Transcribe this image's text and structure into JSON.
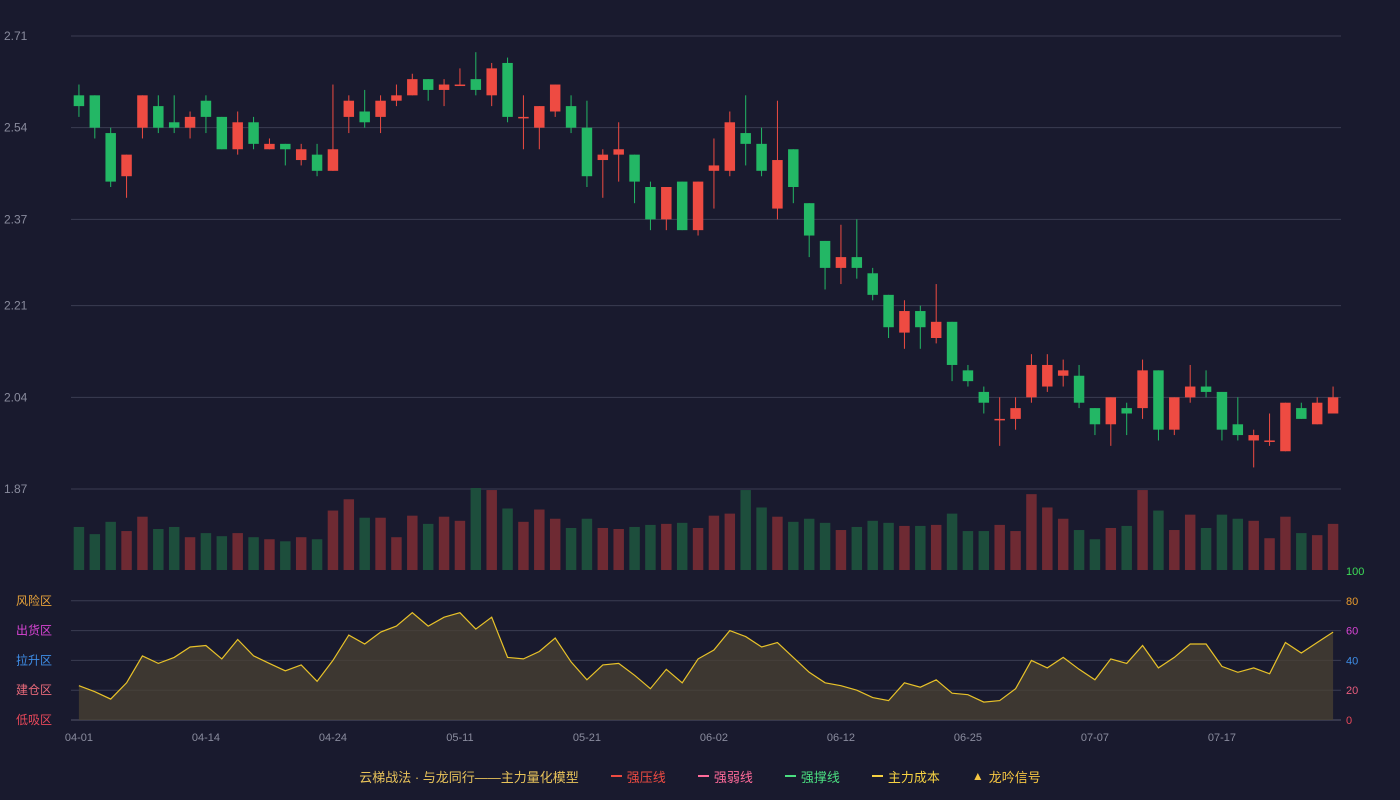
{
  "chart_data": {
    "type": "candlestick",
    "price_axis": {
      "ticks": [
        "2.71",
        "2.54",
        "2.37",
        "2.21",
        "2.04",
        "1.87"
      ],
      "ylim": [
        1.87,
        2.71
      ]
    },
    "x_ticks": [
      {
        "label": "04-01",
        "index": 0
      },
      {
        "label": "04-14",
        "index": 8
      },
      {
        "label": "04-24",
        "index": 16
      },
      {
        "label": "05-11",
        "index": 24
      },
      {
        "label": "05-21",
        "index": 32
      },
      {
        "label": "06-02",
        "index": 40
      },
      {
        "label": "06-12",
        "index": 48
      },
      {
        "label": "06-25",
        "index": 56
      },
      {
        "label": "07-07",
        "index": 64
      },
      {
        "label": "07-17",
        "index": 72
      }
    ],
    "colors": {
      "up": "#ee4b42",
      "down": "#23b765",
      "vol_up": "#6e2a33",
      "vol_down": "#1d4e3c",
      "indicator": "#e8c229"
    },
    "candles": [
      [
        2.6,
        2.58,
        2.62,
        2.56
      ],
      [
        2.6,
        2.54,
        2.6,
        2.52
      ],
      [
        2.53,
        2.44,
        2.54,
        2.43
      ],
      [
        2.45,
        2.49,
        2.49,
        2.41
      ],
      [
        2.54,
        2.6,
        2.6,
        2.52
      ],
      [
        2.58,
        2.54,
        2.6,
        2.53
      ],
      [
        2.55,
        2.54,
        2.6,
        2.53
      ],
      [
        2.54,
        2.56,
        2.57,
        2.52
      ],
      [
        2.59,
        2.56,
        2.6,
        2.53
      ],
      [
        2.56,
        2.5,
        2.56,
        2.5
      ],
      [
        2.5,
        2.55,
        2.57,
        2.49
      ],
      [
        2.55,
        2.51,
        2.56,
        2.5
      ],
      [
        2.5,
        2.51,
        2.52,
        2.5
      ],
      [
        2.51,
        2.5,
        2.51,
        2.47
      ],
      [
        2.48,
        2.5,
        2.51,
        2.47
      ],
      [
        2.49,
        2.46,
        2.51,
        2.45
      ],
      [
        2.46,
        2.5,
        2.62,
        2.46
      ],
      [
        2.56,
        2.59,
        2.6,
        2.53
      ],
      [
        2.57,
        2.55,
        2.61,
        2.54
      ],
      [
        2.56,
        2.59,
        2.6,
        2.53
      ],
      [
        2.59,
        2.6,
        2.62,
        2.58
      ],
      [
        2.6,
        2.63,
        2.64,
        2.6
      ],
      [
        2.63,
        2.61,
        2.63,
        2.59
      ],
      [
        2.61,
        2.62,
        2.63,
        2.58
      ],
      [
        2.62,
        2.62,
        2.65,
        2.62
      ],
      [
        2.63,
        2.61,
        2.68,
        2.6
      ],
      [
        2.6,
        2.65,
        2.66,
        2.58
      ],
      [
        2.66,
        2.56,
        2.67,
        2.55
      ],
      [
        2.56,
        2.56,
        2.6,
        2.5
      ],
      [
        2.54,
        2.58,
        2.58,
        2.5
      ],
      [
        2.57,
        2.62,
        2.62,
        2.56
      ],
      [
        2.58,
        2.54,
        2.6,
        2.53
      ],
      [
        2.54,
        2.45,
        2.59,
        2.43
      ],
      [
        2.48,
        2.49,
        2.5,
        2.41
      ],
      [
        2.49,
        2.5,
        2.55,
        2.44
      ],
      [
        2.49,
        2.44,
        2.49,
        2.4
      ],
      [
        2.43,
        2.37,
        2.44,
        2.35
      ],
      [
        2.37,
        2.43,
        2.43,
        2.35
      ],
      [
        2.44,
        2.35,
        2.44,
        2.35
      ],
      [
        2.35,
        2.44,
        2.44,
        2.34
      ],
      [
        2.46,
        2.47,
        2.52,
        2.39
      ],
      [
        2.46,
        2.55,
        2.57,
        2.45
      ],
      [
        2.53,
        2.51,
        2.6,
        2.47
      ],
      [
        2.51,
        2.46,
        2.54,
        2.45
      ],
      [
        2.39,
        2.48,
        2.59,
        2.37
      ],
      [
        2.5,
        2.43,
        2.5,
        2.4
      ],
      [
        2.4,
        2.34,
        2.4,
        2.3
      ],
      [
        2.33,
        2.28,
        2.33,
        2.24
      ],
      [
        2.28,
        2.3,
        2.36,
        2.25
      ],
      [
        2.3,
        2.28,
        2.37,
        2.26
      ],
      [
        2.27,
        2.23,
        2.28,
        2.22
      ],
      [
        2.23,
        2.17,
        2.23,
        2.15
      ],
      [
        2.16,
        2.2,
        2.22,
        2.13
      ],
      [
        2.2,
        2.17,
        2.21,
        2.13
      ],
      [
        2.15,
        2.18,
        2.25,
        2.14
      ],
      [
        2.18,
        2.1,
        2.18,
        2.07
      ],
      [
        2.09,
        2.07,
        2.1,
        2.06
      ],
      [
        2.05,
        2.03,
        2.06,
        2.01
      ],
      [
        2.0,
        2.0,
        2.04,
        1.95
      ],
      [
        2.0,
        2.02,
        2.04,
        1.98
      ],
      [
        2.04,
        2.1,
        2.12,
        2.03
      ],
      [
        2.06,
        2.1,
        2.12,
        2.05
      ],
      [
        2.08,
        2.09,
        2.11,
        2.06
      ],
      [
        2.08,
        2.03,
        2.1,
        2.02
      ],
      [
        2.02,
        1.99,
        2.02,
        1.97
      ],
      [
        1.99,
        2.04,
        2.04,
        1.95
      ],
      [
        2.02,
        2.01,
        2.03,
        1.97
      ],
      [
        2.02,
        2.09,
        2.11,
        2.0
      ],
      [
        2.09,
        1.98,
        2.09,
        1.96
      ],
      [
        1.98,
        2.04,
        2.04,
        1.97
      ],
      [
        2.04,
        2.06,
        2.1,
        2.03
      ],
      [
        2.06,
        2.05,
        2.09,
        2.04
      ],
      [
        2.05,
        1.98,
        2.05,
        1.96
      ],
      [
        1.99,
        1.97,
        2.04,
        1.96
      ],
      [
        1.96,
        1.97,
        1.98,
        1.91
      ],
      [
        1.96,
        1.96,
        2.01,
        1.95
      ],
      [
        1.94,
        2.03,
        2.03,
        1.94
      ],
      [
        2.02,
        2.0,
        2.03,
        2.0
      ],
      [
        1.99,
        2.03,
        2.04,
        1.99
      ],
      [
        2.01,
        2.04,
        2.06,
        2.01
      ]
    ],
    "volume": [
      42,
      35,
      47,
      38,
      52,
      40,
      42,
      32,
      36,
      33,
      36,
      32,
      30,
      28,
      32,
      30,
      58,
      69,
      51,
      51,
      32,
      53,
      45,
      52,
      48,
      80,
      78,
      60,
      47,
      59,
      50,
      41,
      50,
      41,
      40,
      42,
      44,
      45,
      46,
      41,
      53,
      55,
      78,
      61,
      52,
      47,
      50,
      46,
      39,
      42,
      48,
      46,
      43,
      43,
      44,
      55,
      38,
      38,
      44,
      38,
      74,
      61,
      50,
      39,
      30,
      41,
      43,
      78,
      58,
      39,
      54,
      41,
      54,
      50,
      48,
      31,
      52,
      36,
      34,
      45
    ],
    "indicator": {
      "values": [
        23,
        19,
        14,
        25,
        43,
        38,
        42,
        49,
        50,
        41,
        54,
        43,
        38,
        33,
        37,
        26,
        40,
        57,
        51,
        59,
        63,
        72,
        63,
        69,
        72,
        61,
        69,
        42,
        41,
        46,
        55,
        39,
        27,
        37,
        38,
        30,
        21,
        34,
        25,
        41,
        47,
        60,
        56,
        49,
        52,
        42,
        32,
        25,
        23,
        20,
        15,
        13,
        25,
        22,
        27,
        18,
        17,
        12,
        13,
        21,
        40,
        35,
        42,
        34,
        27,
        41,
        38,
        50,
        35,
        42,
        51,
        51,
        36,
        32,
        35,
        31,
        52,
        45,
        52,
        59
      ],
      "ylim": [
        0,
        100
      ],
      "right_ticks": [
        {
          "label": "100",
          "value": 100,
          "color": "#3ddc57"
        },
        {
          "label": "80",
          "value": 80,
          "color": "#e89a2d"
        },
        {
          "label": "60",
          "value": 60,
          "color": "#d844d4"
        },
        {
          "label": "40",
          "value": 40,
          "color": "#3e8ee8"
        },
        {
          "label": "20",
          "value": 20,
          "color": "#e85c7d"
        },
        {
          "label": "0",
          "value": 0,
          "color": "#e8485a"
        }
      ],
      "zones": [
        {
          "label": "风险区",
          "value": 80,
          "color": "#e8a33a"
        },
        {
          "label": "出货区",
          "value": 60,
          "color": "#d844d4"
        },
        {
          "label": "拉升区",
          "value": 40,
          "color": "#3e8ee8"
        },
        {
          "label": "建仓区",
          "value": 20,
          "color": "#e86a7a"
        },
        {
          "label": "低吸区",
          "value": 0,
          "color": "#e8485a"
        }
      ]
    }
  },
  "footer": {
    "title": "云梯战法 · 与龙同行——主力量化模型",
    "legend": [
      {
        "label": "强压线",
        "color": "#ee4b42",
        "style": "solid"
      },
      {
        "label": "强弱线",
        "color": "#ff6b9a",
        "style": "dashed"
      },
      {
        "label": "强撑线",
        "color": "#4ade80",
        "style": "solid"
      },
      {
        "label": "主力成本",
        "color": "#f5d142",
        "style": "dashed"
      },
      {
        "label": "龙吟信号",
        "color": "#f5c542",
        "style": "triangle"
      }
    ]
  }
}
